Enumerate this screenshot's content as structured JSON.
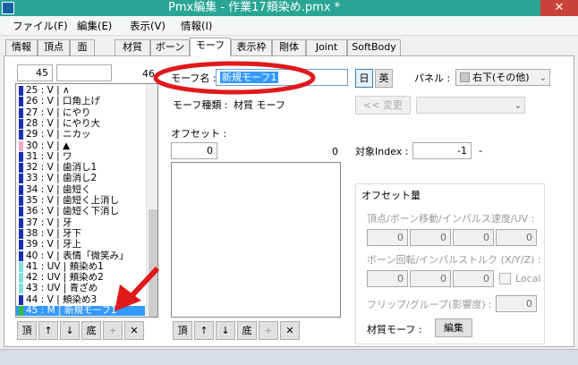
{
  "titlebar": {
    "title": "Pmx編集 - 作業17頬染め.pmx *",
    "close_glyph": "✕"
  },
  "menu": {
    "items": [
      "ファイル(F)",
      "編集(E)",
      "表示(V)",
      "情報(I)"
    ]
  },
  "tabs": [
    "情報",
    "頂点",
    "面",
    "材質",
    "ボーン",
    "モーフ",
    "表示枠",
    "剛体",
    "Joint",
    "SoftBody"
  ],
  "active_tab": "モーフ",
  "left": {
    "index_value": "45",
    "filter_value": "",
    "count": "46",
    "rows": [
      {
        "text": "25 : V  | ∧",
        "color": "#1a2fb0"
      },
      {
        "text": "26 : V  | 口角上げ",
        "color": "#1a2fb0"
      },
      {
        "text": "27 : V  | にやり",
        "color": "#1a2fb0"
      },
      {
        "text": "28 : V  | にやり大",
        "color": "#1a2fb0"
      },
      {
        "text": "29 : V  | ニカッ",
        "color": "#1a2fb0"
      },
      {
        "text": "30 : V  | ▲",
        "color": "#f2a7c6"
      },
      {
        "text": "31 : V  | ワ",
        "color": "#1a2fb0"
      },
      {
        "text": "32 : V  | 歯消し1",
        "color": "#1a2fb0"
      },
      {
        "text": "33 : V  | 歯消し2",
        "color": "#1a2fb0"
      },
      {
        "text": "34 : V  | 歯短く",
        "color": "#1a2fb0"
      },
      {
        "text": "35 : V  | 歯短く上消し",
        "color": "#1a2fb0"
      },
      {
        "text": "36 : V  | 歯短く下消し",
        "color": "#1a2fb0"
      },
      {
        "text": "37 : V  | 牙",
        "color": "#1a2fb0"
      },
      {
        "text": "38 : V  | 牙下",
        "color": "#1a2fb0"
      },
      {
        "text": "39 : V  | 牙上",
        "color": "#1a2fb0"
      },
      {
        "text": "40 : V  | 表情「微笑み」",
        "color": "#1a2fb0"
      },
      {
        "text": "41 : UV | 頬染め1",
        "color": "#7fdde0"
      },
      {
        "text": "42 : UV | 頬染め2",
        "color": "#7fdde0"
      },
      {
        "text": "43 : UV | 青ざめ",
        "color": "#7fdde0"
      },
      {
        "text": "44 : V  | 頬染め3",
        "color": "#1a2fb0"
      },
      {
        "text": "45 : M  | 新規モーフ1",
        "color": "#2fbf2f"
      }
    ],
    "selected_index": 20,
    "buttons": [
      "頂",
      "↑",
      "↓",
      "底",
      "+",
      "✕"
    ]
  },
  "morph": {
    "name_label": "モーフ名 :",
    "name_value": "新規モーフ1",
    "lang_jp": "日",
    "lang_en": "英",
    "panel_label": "パネル :",
    "panel_value": "右下(その他)",
    "type_label": "モーフ種類 :",
    "type_value": "材質 モーフ",
    "convert_button": "<< 変更",
    "offset_label": "オフセット :",
    "offset_index_value": "0",
    "offset_count": "0",
    "target_index_label": "対象Index :",
    "target_index_value": "-1",
    "target_index_suffix": "-",
    "offset_buttons": [
      "頂",
      "↑",
      "↓",
      "底",
      "+",
      "✕"
    ]
  },
  "offset_group": {
    "title": "オフセット量",
    "vertex_label": "頂点/ボーン移動/インパルス速度/UV :",
    "vertex_values": [
      "0",
      "0",
      "0",
      "0"
    ],
    "rotation_label": "ボーン回転/インパルストルク (X/Y/Z) :",
    "rotation_values": [
      "0",
      "0",
      "0"
    ],
    "local_label": "Local",
    "flip_label": "フリップ/グループ(影響度) :",
    "flip_value": "0",
    "material_label": "材質モーフ :",
    "edit_button": "編集"
  },
  "annotation": {
    "ellipse_color": "#e0191b",
    "arrow_color": "#e0191b"
  }
}
